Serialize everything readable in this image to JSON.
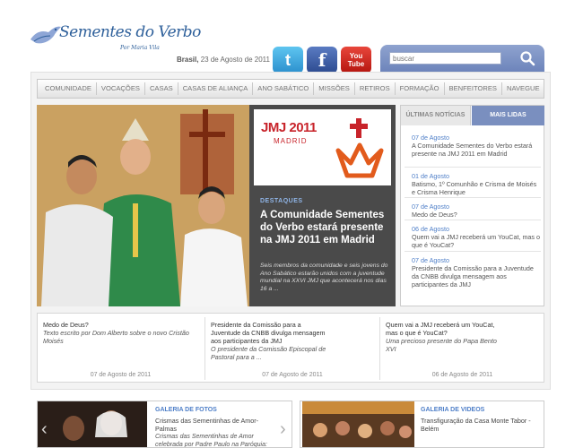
{
  "logo": {
    "title": "Sementes do Verbo",
    "subtitle": "Por Maria Vila"
  },
  "header": {
    "date_place": "Brasil,",
    "date_text": "23 de Agosto de 2011"
  },
  "social": {
    "twitter": "t",
    "facebook": "f",
    "youtube_top": "You",
    "youtube_bottom": "Tube"
  },
  "search": {
    "placeholder": "buscar"
  },
  "nav": {
    "items": [
      "COMUNIDADE",
      "VOCAÇÕES",
      "CASAS",
      "CASAS DE ALIANÇA",
      "ANO SABÁTICO",
      "MISSÕES",
      "RETIROS",
      "FORMAÇÃO",
      "BENFEITORES",
      "NAVEGUE"
    ]
  },
  "hero": {
    "banner_title": "JMJ 2011",
    "banner_sub": "MADRID",
    "section": "DESTAQUES",
    "title": "A Comunidade Sementes do Verbo estará presente na JMJ 2011 em Madrid",
    "summary": "Seis membros da comunidade e seis jovens do Ano Sabático estarão unidos com a juventude mundial na XXVI JMJ que acontecerá nos dias 16 a ..."
  },
  "tabs": {
    "tab1": "ÚLTIMAS NOTÍCIAS",
    "tab2": "MAIS LIDAS"
  },
  "news": [
    {
      "date": "07 de Agosto",
      "title": "A Comunidade Sementes do Verbo estará presente na JMJ 2011 em Madrid"
    },
    {
      "date": "01 de Agosto",
      "title": "Batismo, 1º Comunhão e Crisma de Moisés e Crisma Henrique"
    },
    {
      "date": "07 de Agosto",
      "title": "Medo de Deus?"
    },
    {
      "date": "06 de Agosto",
      "title": "Quem vai a JMJ receberá um YouCat, mas o que é YouCat?"
    },
    {
      "date": "07 de Agosto",
      "title": "Presidente da Comissão para a Juventude da CNBB divulga mensagem aos participantes da JMJ"
    }
  ],
  "strip": [
    {
      "title": "Medo de Deus?",
      "sub": "Texto escrito por Dom Alberto sobre o novo Cristão Moisés",
      "date": "07 de Agosto de 2011"
    },
    {
      "title": "Presidente da Comissão para a Juventude da CNBB divulga mensagem aos participantes da JMJ",
      "sub": "O presidente da Comissão Episcopal de Pastoral para a ...",
      "date": "07 de Agosto de 2011"
    },
    {
      "title": "Quem vai a JMJ receberá um YouCat, mas o que é YouCat?",
      "sub": "Uma precioso presente do Papa Bento XVI",
      "date": "06 de Agosto de 2011"
    }
  ],
  "gallery_photos": {
    "label": "GALERIA DE FOTOS",
    "title": "Crismas das Sementinhas de Amor-Palmas",
    "sub": "Crismas das Sementinhas de Amor celebrada por Padre Paulo na Paróquia:"
  },
  "gallery_videos": {
    "label": "GALERIA DE VIDEOS",
    "title": "Transfiguração da Casa Monte Tabor - Belém"
  },
  "colors": {
    "accent": "#4f7fc8",
    "nav_bg": "#e2e2e2",
    "tab_active": "#7a8fbf",
    "hero_panel": "#4a4a4a"
  }
}
